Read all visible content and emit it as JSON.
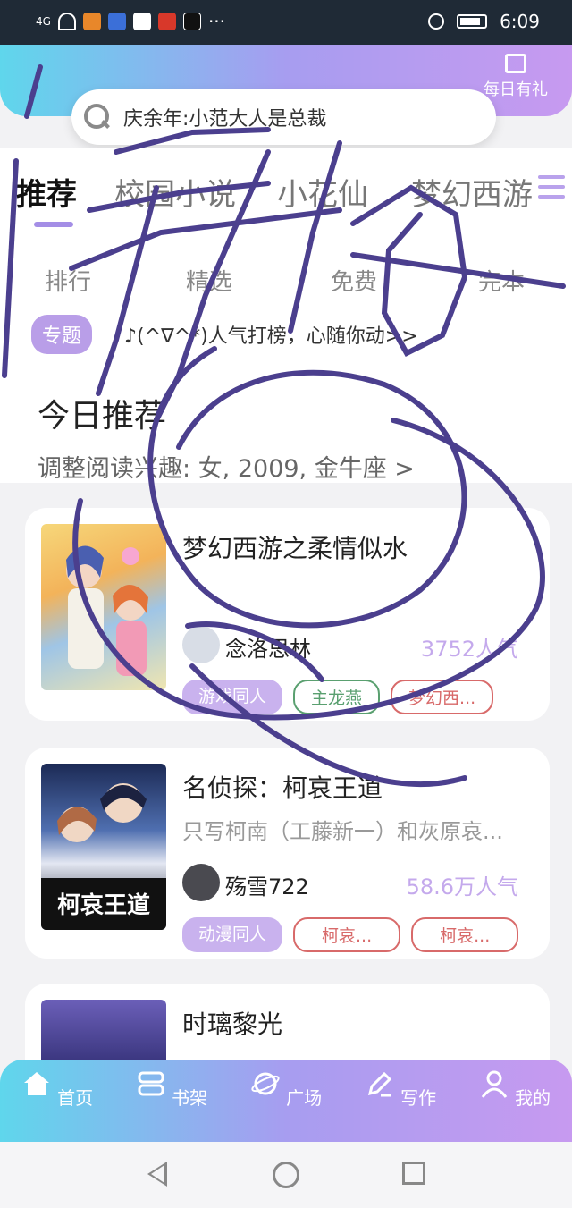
{
  "status_bar": {
    "time": "6:09",
    "signal": "4G",
    "colors": {
      "bg": "#1f2a36"
    }
  },
  "header": {
    "gift_label": "每日有礼",
    "search_placeholder": "庆余年:小范大人是总裁"
  },
  "tabs": [
    "推荐",
    "校园小说",
    "小花仙",
    "梦幻西游"
  ],
  "subnav": [
    "排行",
    "精选",
    "免费",
    "完本"
  ],
  "topic": {
    "badge": "专题",
    "text": "♪(^∇^*)人气打榜，心随你动>>"
  },
  "recommend": {
    "title": "今日推荐",
    "subtitle": "调整阅读兴趣: 女, 2009, 金牛座 >"
  },
  "books": [
    {
      "title": "梦幻西游之柔情似水",
      "desc": "",
      "author": "念洛思林",
      "popularity": "3752人气",
      "tags": [
        "游戏同人",
        "主龙燕",
        "梦幻西..."
      ]
    },
    {
      "title": "名侦探：柯哀王道",
      "desc": "只写柯南（工藤新一）和灰原哀...",
      "author": "殇雪722",
      "popularity": "58.6万人气",
      "tags": [
        "动漫同人",
        "柯哀...",
        "柯哀..."
      ],
      "cover_text": "柯哀王道"
    },
    {
      "title": "时璃黎光",
      "desc": "",
      "author": "",
      "popularity": "",
      "tags": []
    }
  ],
  "bottom_nav": [
    "首页",
    "书架",
    "广场",
    "写作",
    "我的"
  ],
  "colors": {
    "accent": "#a48ee6",
    "scribble": "#4b3f8e"
  }
}
